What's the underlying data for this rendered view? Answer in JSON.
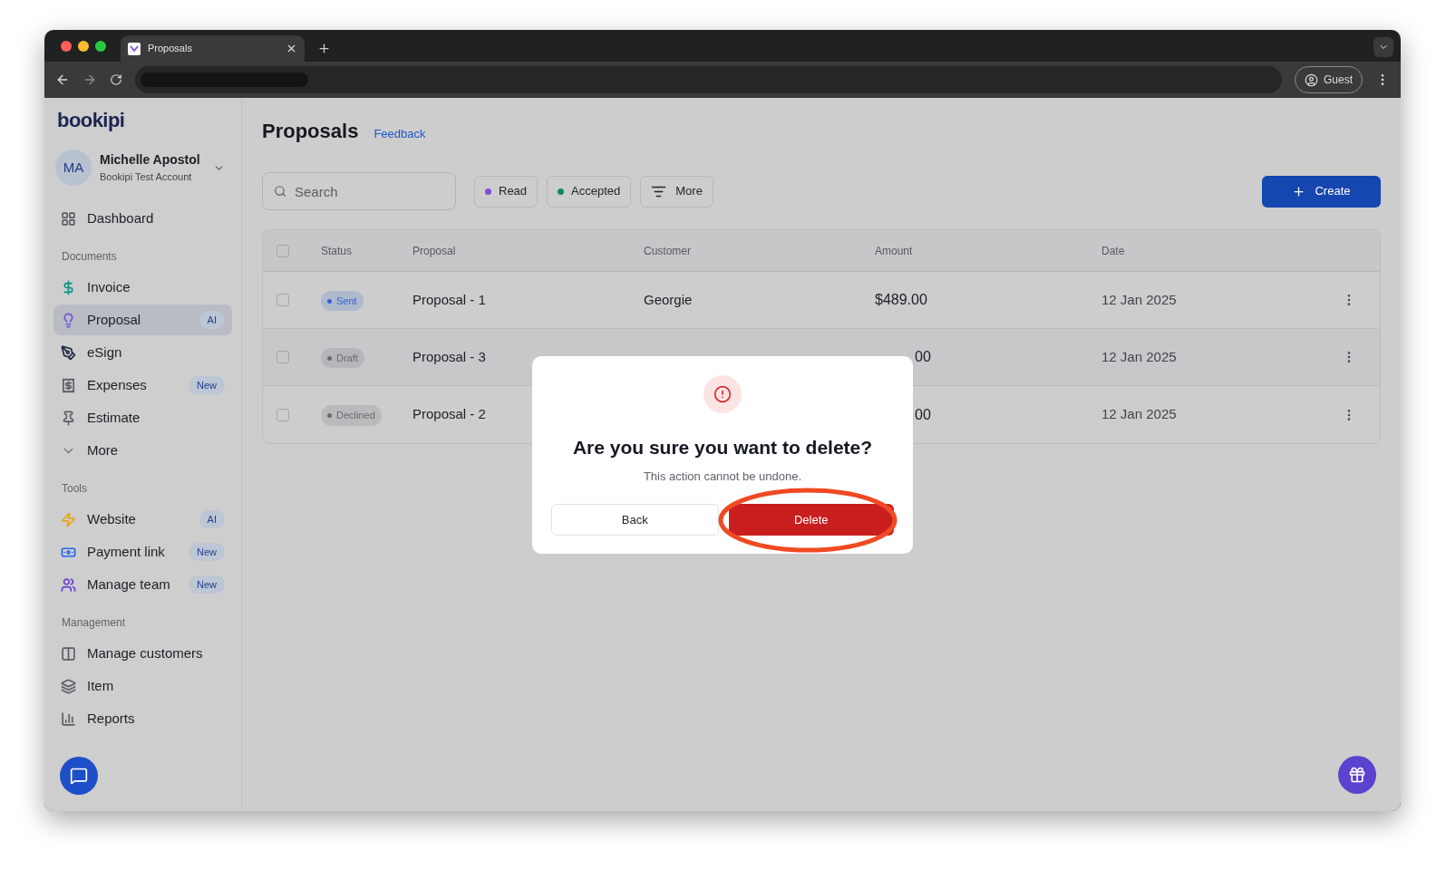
{
  "browser": {
    "tab_title": "Proposals",
    "profile": "Guest"
  },
  "sidebar": {
    "logo": "bookipi",
    "user": {
      "initials": "MA",
      "name": "Michelle Apostol",
      "account": "Bookipi Test Account"
    },
    "top_items": [
      {
        "label": "Dashboard",
        "kind": "link",
        "selected": false
      }
    ],
    "sections": [
      {
        "title": "Documents",
        "items": [
          {
            "label": "Invoice",
            "kind": "link",
            "selected": false
          },
          {
            "label": "Proposal",
            "kind": "link",
            "selected": true,
            "badge": "AI"
          },
          {
            "label": "eSign",
            "kind": "link",
            "selected": false
          },
          {
            "label": "Expenses",
            "kind": "link",
            "selected": false,
            "badge": "New"
          },
          {
            "label": "Estimate",
            "kind": "link",
            "selected": false
          },
          {
            "label": "More",
            "kind": "expander",
            "selected": false
          }
        ]
      },
      {
        "title": "Tools",
        "items": [
          {
            "label": "Website",
            "kind": "link",
            "selected": false,
            "badge": "AI"
          },
          {
            "label": "Payment link",
            "kind": "link",
            "selected": false,
            "badge": "New"
          },
          {
            "label": "Manage team",
            "kind": "link",
            "selected": false,
            "badge": "New"
          }
        ]
      },
      {
        "title": "Management",
        "items": [
          {
            "label": "Manage customers",
            "kind": "link",
            "selected": false
          },
          {
            "label": "Item",
            "kind": "link",
            "selected": false
          },
          {
            "label": "Reports",
            "kind": "link",
            "selected": false
          }
        ]
      }
    ]
  },
  "page": {
    "title": "Proposals",
    "feedback": "Feedback",
    "search_placeholder": "Search",
    "filters": [
      {
        "label": "Read",
        "color": "#7c4fd8"
      },
      {
        "label": "Accepted",
        "color": "#138a5c"
      }
    ],
    "more_filter": "More",
    "create": "Create"
  },
  "table": {
    "all_selected": false,
    "columns": [
      "Status",
      "Proposal",
      "Customer",
      "Amount",
      "Date"
    ],
    "rows": [
      {
        "status": "Sent",
        "color": "#2f63d6",
        "proposal": "Proposal - 1",
        "customer": "Georgie",
        "amount": "$489.00",
        "date": "12 Jan 2025",
        "checked": false
      },
      {
        "status": "Draft",
        "color": "#666a70",
        "proposal": "Proposal - 3",
        "amount_tail": "00",
        "date": "12 Jan 2025",
        "checked": false
      },
      {
        "status": "Declined",
        "color": "#666a70",
        "proposal": "Proposal - 2",
        "amount_tail": "00",
        "date": "12 Jan 2025",
        "checked": false
      }
    ]
  },
  "modal": {
    "title": "Are you sure you want to delete?",
    "message": "This action cannot be undone.",
    "back": "Back",
    "delete": "Delete",
    "delete_highlighted": true
  }
}
